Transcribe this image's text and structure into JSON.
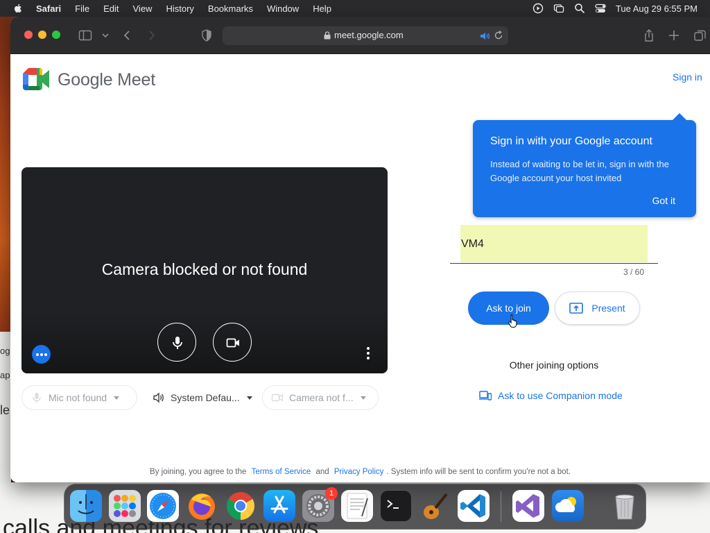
{
  "menubar": {
    "app": "Safari",
    "items": [
      "File",
      "Edit",
      "View",
      "History",
      "Bookmarks",
      "Window",
      "Help"
    ],
    "clock": "Tue Aug 29  6:55 PM"
  },
  "browser": {
    "url": "meet.google.com"
  },
  "meet": {
    "logo_text": "Google Meet",
    "sign_in": "Sign in",
    "video_message": "Camera blocked or not found",
    "mic_selector": "Mic not found",
    "speaker_selector": "System Defau...",
    "camera_selector": "Camera not f...",
    "tooltip": {
      "title": "Sign in with your Google account",
      "body": "Instead of waiting to be let in, sign in with the Google account your host invited",
      "button": "Got it"
    },
    "name_input_value": "VM4",
    "name_counter": "3 / 60",
    "ask_to_join": "Ask to join",
    "present": "Present",
    "other_options": "Other joining options",
    "companion_mode": "Ask to use Companion mode",
    "footer": {
      "pre": "By joining, you agree to the",
      "tos": "Terms of Service",
      "and": "and",
      "privacy": "Privacy Policy",
      "post": ". System info will be sent to confirm you're not a bot."
    }
  },
  "background": {
    "doc_text": "calls and meetings for reviews",
    "left_strip": [
      "ogl",
      "app",
      "le"
    ]
  },
  "dock": {
    "apps": [
      "Finder",
      "Launchpad",
      "Safari",
      "Firefox",
      "Chrome",
      "App Store",
      "System Settings",
      "TextEdit",
      "Terminal",
      "GarageBand",
      "Visual Studio Code",
      "Visual Studio",
      "Weather",
      "Trash"
    ],
    "settings_badge": "1"
  },
  "colors": {
    "accent": "#1a73e8",
    "name_field_fill": "#f1f7b5",
    "video_bg": "#202124"
  }
}
